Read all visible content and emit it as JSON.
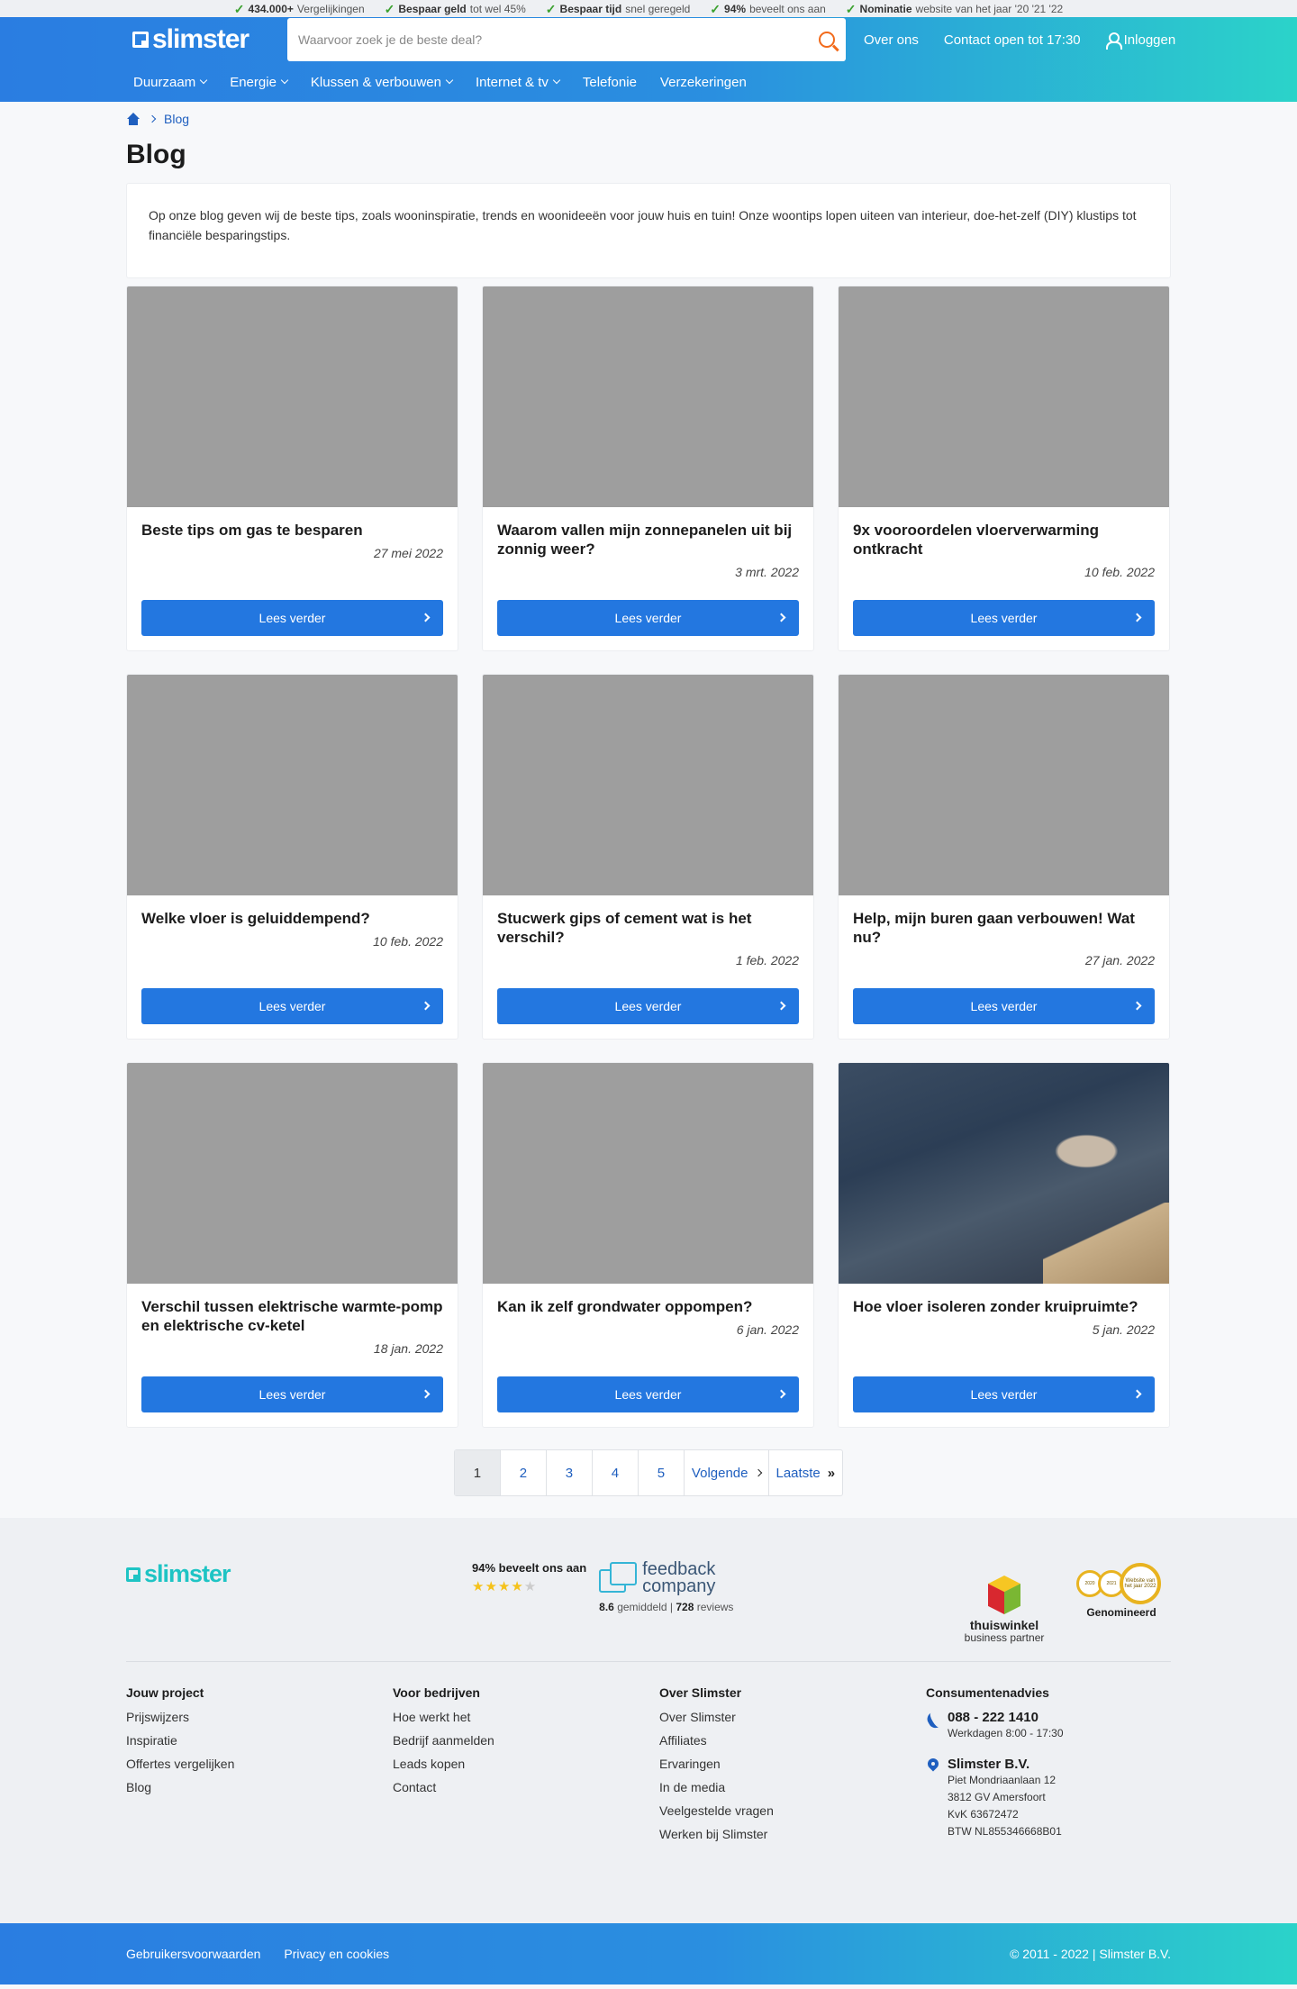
{
  "usp": [
    {
      "bold": "434.000+",
      "text": "Vergelijkingen"
    },
    {
      "bold": "Bespaar geld",
      "text": "tot wel 45%"
    },
    {
      "bold": "Bespaar tijd",
      "text": "snel geregeld"
    },
    {
      "bold": "94%",
      "text": "beveelt ons aan"
    },
    {
      "bold": "Nominatie",
      "text": "website van het jaar '20 '21 '22"
    }
  ],
  "header": {
    "logo": "slimster",
    "search_placeholder": "Waarvoor zoek je de beste deal?",
    "links": {
      "about": "Over ons",
      "contact": "Contact open tot 17:30",
      "login": "Inloggen"
    }
  },
  "nav": [
    "Duurzaam",
    "Energie",
    "Klussen & verbouwen",
    "Internet & tv",
    "Telefonie",
    "Verzekeringen"
  ],
  "breadcrumb": {
    "current": "Blog"
  },
  "page": {
    "title": "Blog",
    "intro": "Op onze blog geven wij de beste tips, zoals wooninspiratie, trends en woonideeën voor jouw huis en tuin! Onze woontips lopen uiteen van interieur, doe-het-zelf (DIY) klustips tot financiële besparingstips."
  },
  "read_more": "Lees verder",
  "posts": [
    {
      "title": "Beste tips om gas te besparen",
      "date": "27 mei 2022"
    },
    {
      "title": "Waarom vallen mijn zonnepanelen uit bij zonnig weer?",
      "date": "3 mrt. 2022"
    },
    {
      "title": "9x vooroordelen vloerverwarming ontkracht",
      "date": "10 feb. 2022"
    },
    {
      "title": "Welke vloer is geluiddempend?",
      "date": "10 feb. 2022"
    },
    {
      "title": "Stucwerk gips of cement wat is het verschil?",
      "date": "1 feb. 2022"
    },
    {
      "title": "Help, mijn buren gaan verbouwen! Wat nu?",
      "date": "27 jan. 2022"
    },
    {
      "title": "Verschil tussen elektrische warmte-pomp en elektrische cv-ketel",
      "date": "18 jan. 2022"
    },
    {
      "title": "Kan ik zelf grondwater oppompen?",
      "date": "6 jan. 2022"
    },
    {
      "title": "Hoe vloer isoleren zonder kruipruimte?",
      "date": "5 jan. 2022"
    }
  ],
  "pagination": {
    "pages": [
      "1",
      "2",
      "3",
      "4",
      "5"
    ],
    "next": "Volgende",
    "last": "Laatste",
    "active": "1"
  },
  "footer": {
    "logo": "slimster",
    "recommend": "94% beveelt ons aan",
    "rating_stars": 4,
    "feedback_name_1": "feedback",
    "feedback_name_2": "company",
    "feedback_score": "8.6",
    "feedback_score_label": "gemiddeld |",
    "feedback_reviews": "728",
    "feedback_reviews_label": "reviews",
    "thuiswinkel_title": "thuiswinkel",
    "thuiswinkel_sub": "business partner",
    "medal_years": [
      "2020",
      "2021"
    ],
    "medal_big": "Website van het jaar 2022",
    "award_label": "Genomineerd",
    "columns": [
      {
        "title": "Jouw project",
        "links": [
          "Prijswijzers",
          "Inspiratie",
          "Offertes vergelijken",
          "Blog"
        ]
      },
      {
        "title": "Voor bedrijven",
        "links": [
          "Hoe werkt het",
          "Bedrijf aanmelden",
          "Leads kopen",
          "Contact"
        ]
      },
      {
        "title": "Over Slimster",
        "links": [
          "Over Slimster",
          "Affiliates",
          "Ervaringen",
          "In de media",
          "Veelgestelde vragen",
          "Werken bij Slimster"
        ]
      }
    ],
    "contact": {
      "title": "Consumentenadvies",
      "phone": "088 - 222 1410",
      "hours": "Werkdagen 8:00 - 17:30",
      "company": "Slimster B.V.",
      "address1": "Piet Mondriaanlaan 12",
      "address2": "3812 GV Amersfoort",
      "kvk": "KvK 63672472",
      "btw": "BTW NL855346668B01"
    },
    "bottom_links": [
      "Gebruikersvoorwaarden",
      "Privacy en cookies"
    ],
    "copyright": "© 2011 - 2022 | Slimster B.V."
  },
  "colors": {
    "primary": "#2377e0",
    "accent_teal": "#2bd3c9",
    "search_icon": "#f26a1b"
  }
}
